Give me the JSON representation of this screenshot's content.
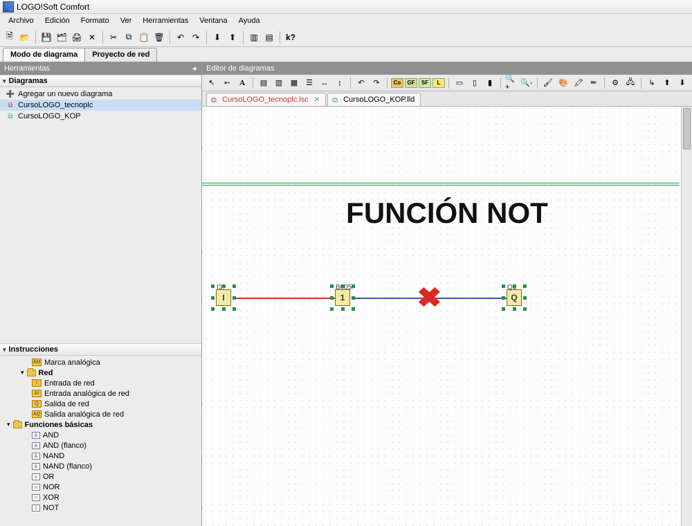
{
  "app": {
    "title": "LOGO!Soft Comfort"
  },
  "menubar": [
    "Archivo",
    "Edición",
    "Formato",
    "Ver",
    "Herramientas",
    "Ventana",
    "Ayuda"
  ],
  "tabs_top": {
    "diagram_mode": "Modo de diagrama",
    "net_project": "Proyecto de red"
  },
  "left": {
    "tools_title": "Herramientas",
    "diagrams_title": "Diagramas",
    "add_new": "Agregar un nuevo diagrama",
    "items": [
      {
        "label": "CursoLOGO_tecnoplc",
        "selected": true
      },
      {
        "label": "CursoLOGO_KOP",
        "selected": false
      }
    ],
    "instructions_title": "Instrucciones",
    "marca": "Marca analógica",
    "red": {
      "label": "Red",
      "children": [
        "Entrada de red",
        "Entrada analógica de red",
        "Salida de red",
        "Salida analógica de red"
      ]
    },
    "basics": {
      "label": "Funciones básicas",
      "children": [
        "AND",
        "AND (flanco)",
        "NAND",
        "NAND (flanco)",
        "OR",
        "NOR",
        "XOR",
        "NOT"
      ]
    }
  },
  "editor": {
    "title": "Editor de diagramas",
    "tool_boxes": {
      "co": "Co",
      "gf": "GF",
      "sf": "SF",
      "l": "L"
    },
    "doc_tabs": [
      {
        "label": "CursoLOGO_tecnoplc.lsc",
        "active": true,
        "closable": true
      },
      {
        "label": "CursoLOGO_KOP.lld",
        "active": false,
        "closable": false
      }
    ],
    "canvas": {
      "title_text": "FUNCIÓN NOT",
      "blocks": {
        "i": {
          "label": "I3.",
          "text": "I"
        },
        "b": {
          "label": "B005.",
          "text": "1"
        },
        "q": {
          "label": "Q3",
          "text": "Q"
        }
      }
    }
  }
}
